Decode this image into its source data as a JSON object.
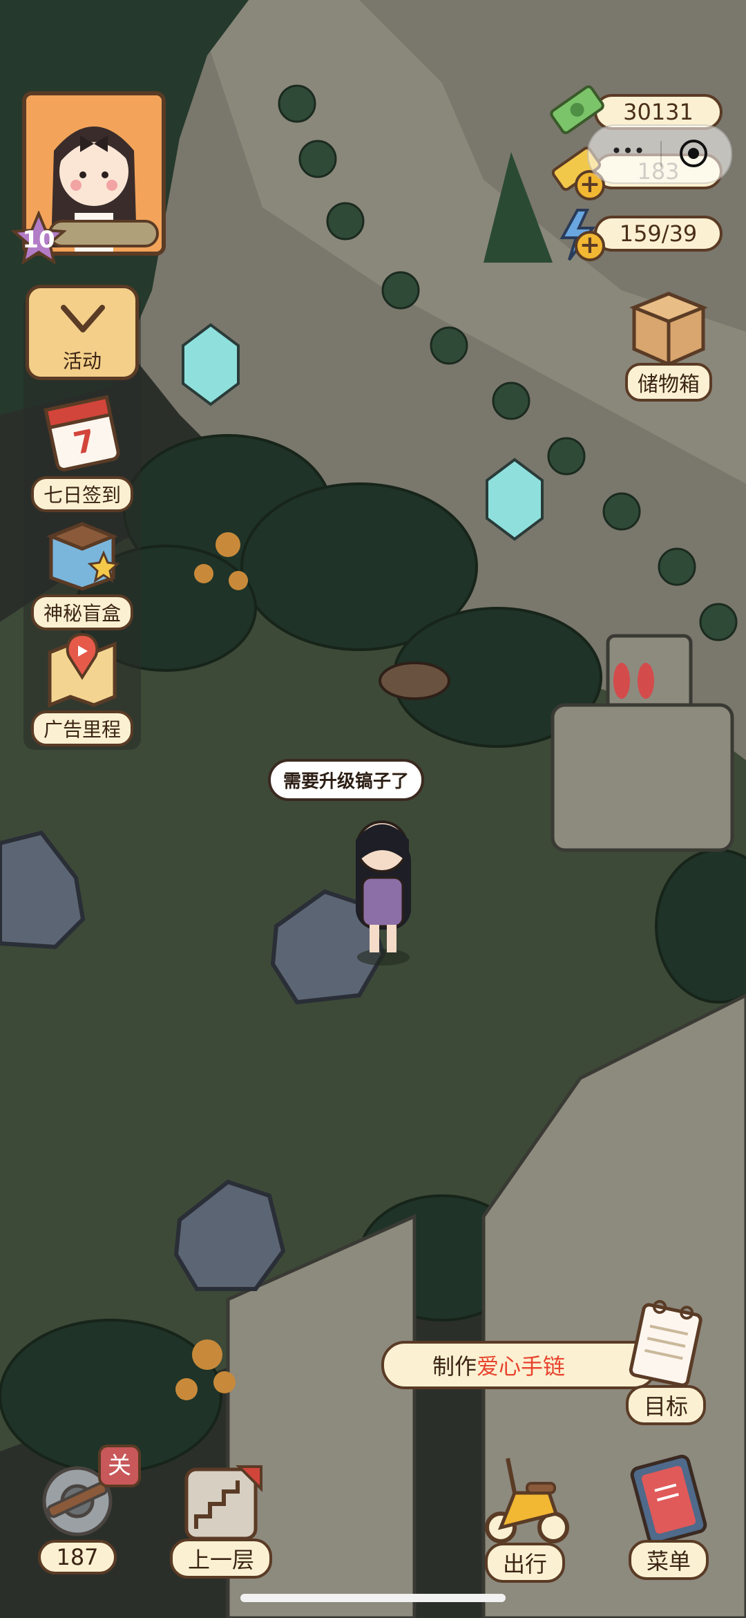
{
  "hud": {
    "level": "10",
    "cash": "30131",
    "gold": "183",
    "energy": "159/39"
  },
  "side_menu": {
    "activity": "活动",
    "seven_day_signin": "七日签到",
    "mystery_box": "神秘盲盒",
    "ad_mileage": "广告里程"
  },
  "storage": {
    "label": "储物箱"
  },
  "speech": "需要升级镐子了",
  "goal": {
    "prefix": "制作",
    "highlight": "爱心手链",
    "button": "目标",
    "highlight_color": "#e8432e"
  },
  "bottom": {
    "gear_count": "187",
    "gear_badge": "关",
    "up_floor": "上一层",
    "travel": "出行",
    "menu": "菜单"
  },
  "miniprogram": {
    "more": "•••"
  },
  "colors": {
    "outline": "#5a3b25",
    "pill_bg": "#fbf1d2",
    "grass": "#3d4a38",
    "rock": "#6b6f66"
  }
}
